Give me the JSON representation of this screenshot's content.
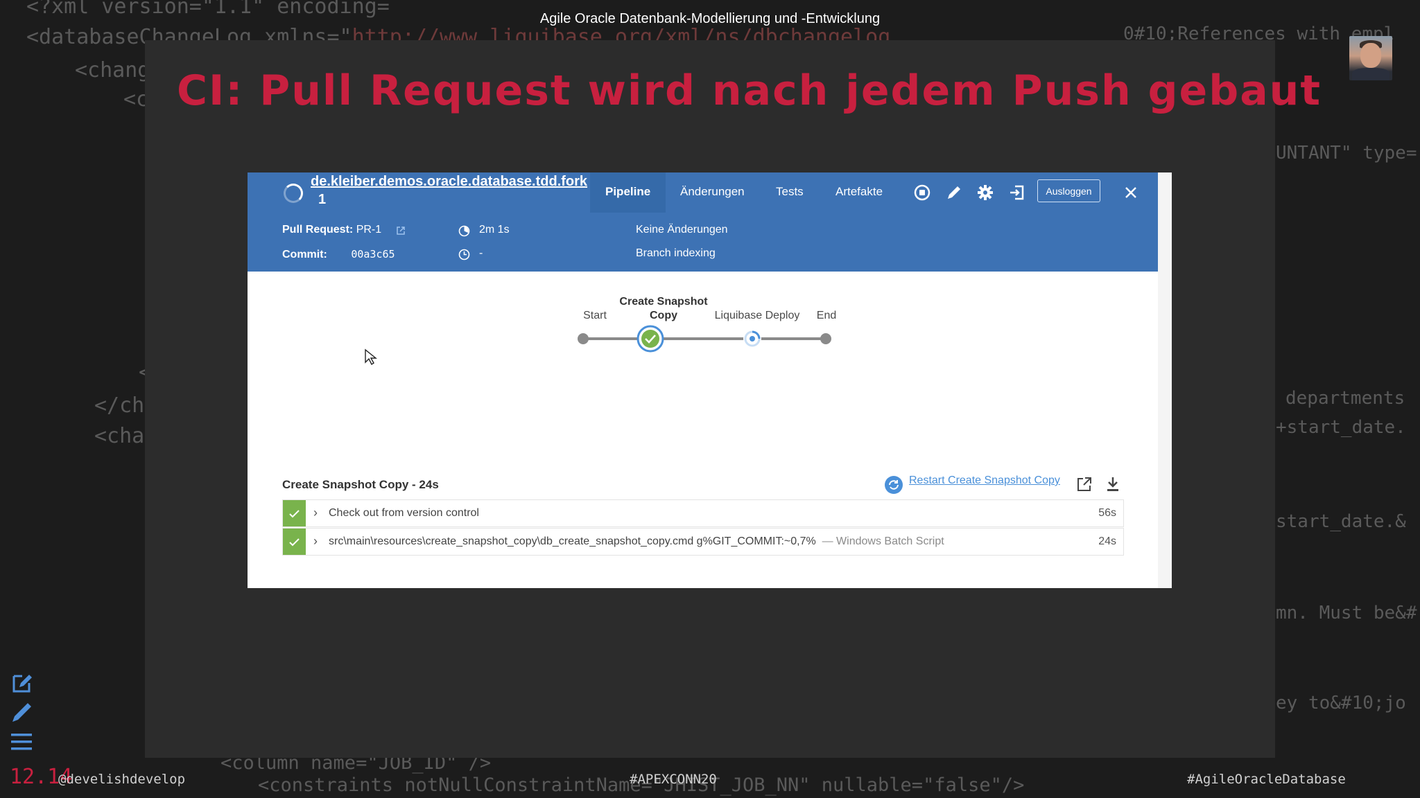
{
  "video_title": "Agile Oracle Datenbank-Modellierung und -Entwicklung",
  "slide": {
    "title": "CI: Pull Request wird nach jedem Push gebaut",
    "page_number": "12.14"
  },
  "footer": {
    "left": "@develishdevelop",
    "center": "#APEXCONN20",
    "right": "#AgileOracleDatabase"
  },
  "background_code": {
    "l1a": "<?xml version=\"1.1\" encoding=",
    "l2a": "<databaseChangeLog xmlns=\"",
    "l2b": "http://www.liquibase.org/xml/ns/dbchangelog",
    "l3": "<chang",
    "l4": "<c",
    "l5": "<",
    "l6": "</cha",
    "l7": "<cha",
    "r1": "0#10;References with empl",
    "r2": "UNTANT\" type=",
    "r3": "departments",
    "r4": "+start_date.",
    "r5": "start_date.&",
    "r6": "mn. Must be&#",
    "r7": "ey to&#10;jo",
    "b1": "<column name=\"JOB_ID\" />",
    "b2": "<constraints notNullConstraintName=\"JHIST_JOB_NN\" nullable=\"false\"/>"
  },
  "jenkins": {
    "job_name": "de.kleiber.demos.oracle.database.tdd.fork",
    "run_number": "1",
    "tabs": [
      "Pipeline",
      "Änderungen",
      "Tests",
      "Artefakte"
    ],
    "logout_label": "Ausloggen",
    "pull_request_label": "Pull Request:",
    "pull_request_value": "PR-1",
    "commit_label": "Commit:",
    "commit_value": "00a3c65",
    "duration": "2m 1s",
    "time_ago": "-",
    "changes": "Keine Änderungen",
    "cause": "Branch indexing",
    "stages": {
      "start": "Start",
      "snapshot_line1": "Create Snapshot",
      "snapshot_line2": "Copy",
      "deploy": "Liquibase Deploy",
      "end": "End"
    },
    "step_panel_title": "Create Snapshot Copy - 24s",
    "restart_label": "Restart Create Snapshot Copy",
    "steps": [
      {
        "text": "Check out from version control",
        "subtext": "",
        "duration": "56s",
        "status": "success"
      },
      {
        "text": "src\\main\\resources\\create_snapshot_copy\\db_create_snapshot_copy.cmd g%GIT_COMMIT:~0,7%",
        "subtext": "— Windows Batch Script",
        "duration": "24s",
        "status": "success"
      }
    ],
    "colors": {
      "header": "#3d72b4",
      "success": "#79b34c",
      "running": "#4a90d9"
    }
  }
}
